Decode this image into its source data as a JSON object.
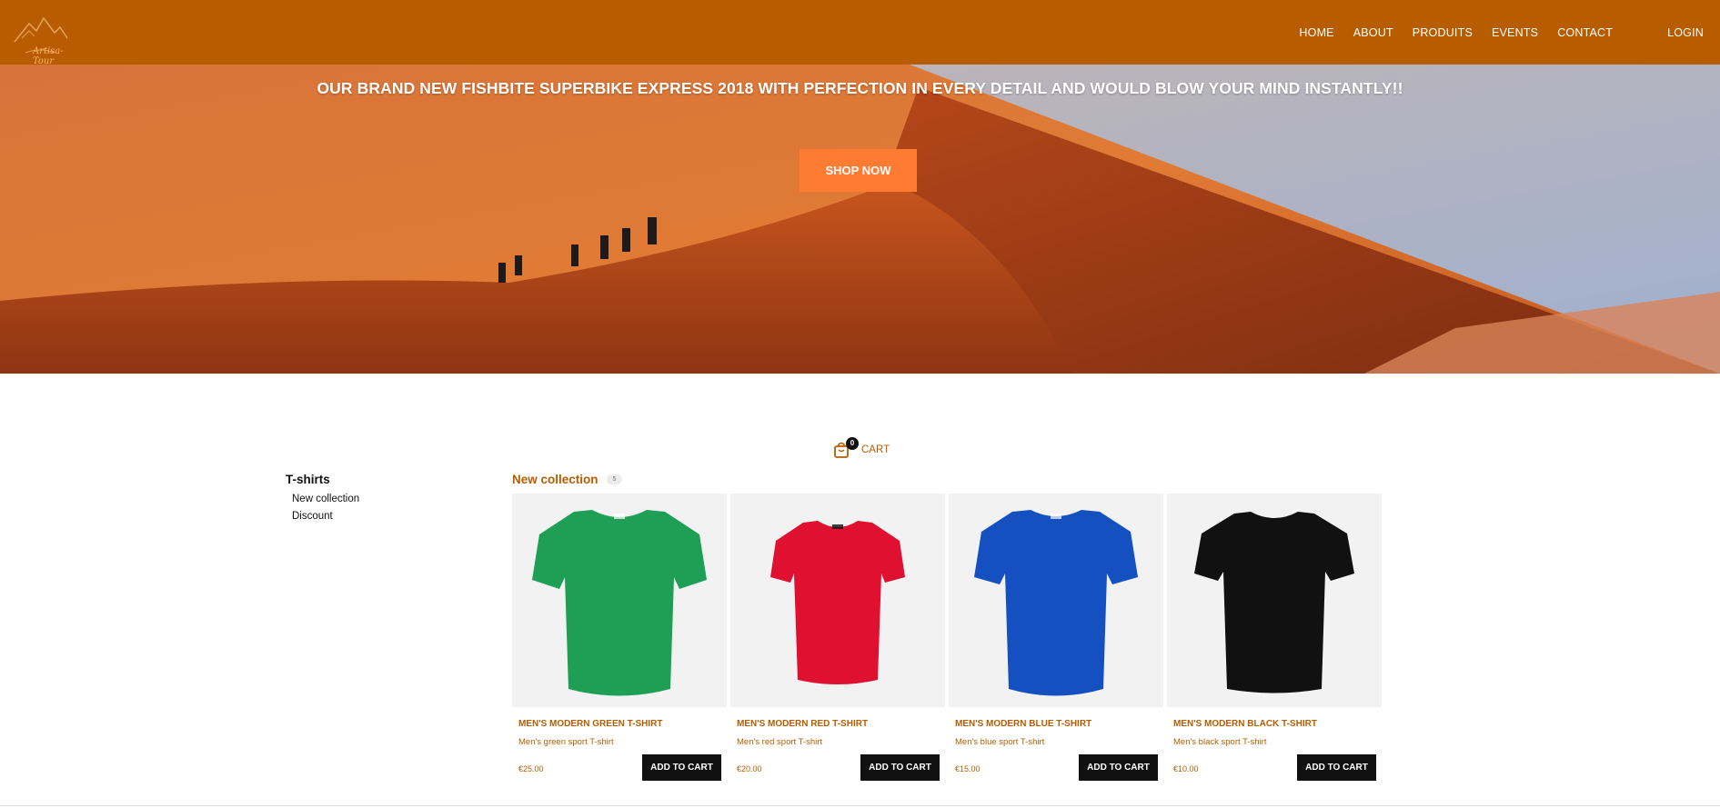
{
  "header": {
    "logo_text": "Artisa-Tour",
    "nav": [
      "HOME",
      "ABOUT",
      "PRODUITS",
      "EVENTS",
      "CONTACT"
    ],
    "login": "LOGIN"
  },
  "hero": {
    "title": "OUR BRAND NEW FISHBITE SUPERBIKE EXPRESS 2018 WITH PERFECTION IN EVERY DETAIL AND WOULD BLOW YOUR MIND INSTANTLY!!",
    "button": "SHOP NOW"
  },
  "cart": {
    "count": "0",
    "label": "CART"
  },
  "sidebar": {
    "title": "T-shirts",
    "items": [
      "New collection",
      "Discount"
    ]
  },
  "collection": {
    "title": "New collection",
    "count": "5"
  },
  "products": [
    {
      "name": "MEN'S MODERN GREEN T-SHIRT",
      "desc": "Men's green sport T-shirt",
      "price": "€25.00",
      "button": "ADD TO CART",
      "color": "#1f9e55"
    },
    {
      "name": "MEN'S MODERN RED T-SHIRT",
      "desc": "Men's red sport T-shirt",
      "price": "€20.00",
      "button": "ADD TO CART",
      "color": "#e01030"
    },
    {
      "name": "MEN'S MODERN BLUE T-SHIRT",
      "desc": "Men's blue sport T-shirt",
      "price": "€15.00",
      "button": "ADD TO CART",
      "color": "#1550c0"
    },
    {
      "name": "MEN'S MODERN BLACK T-SHIRT",
      "desc": "Men's black sport T-shirt",
      "price": "€10.00",
      "button": "ADD TO CART",
      "color": "#111111"
    }
  ],
  "colors": {
    "header": "#b85c00",
    "accent_button": "#fe7b32",
    "text_accent": "#b85c00"
  }
}
